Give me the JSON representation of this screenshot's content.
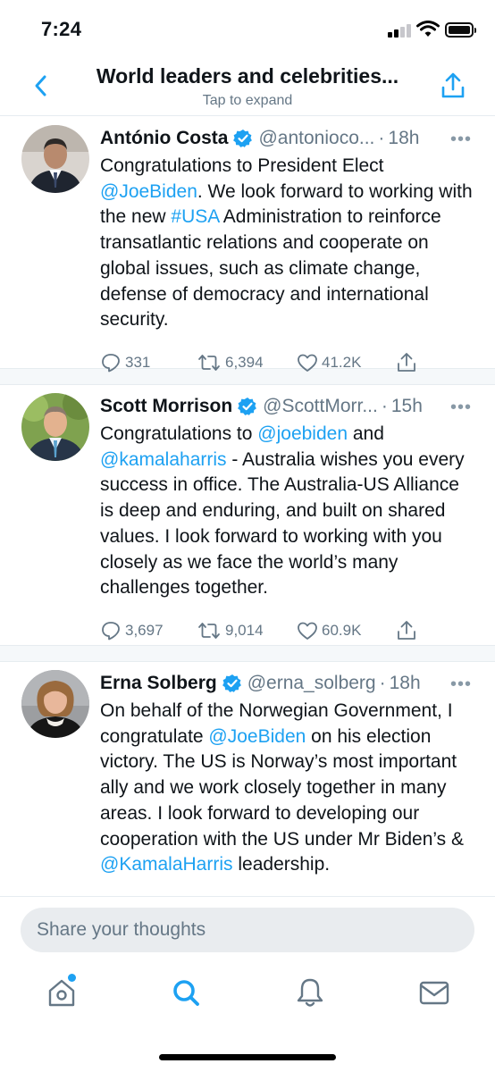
{
  "status_bar": {
    "time": "7:24"
  },
  "header": {
    "title": "World leaders and celebrities...",
    "subtitle": "Tap to expand"
  },
  "tweets": [
    {
      "name": "António Costa",
      "handle": "@antonioco...",
      "age": "18h",
      "dot": "·",
      "replies": "331",
      "retweets": "6,394",
      "likes": "41.2K"
    },
    {
      "name": "Scott Morrison",
      "handle": "@ScottMorr...",
      "age": "15h",
      "dot": "·",
      "replies": "3,697",
      "retweets": "9,014",
      "likes": "60.9K"
    },
    {
      "name": "Erna Solberg",
      "handle": "@erna_solberg",
      "age": "18h",
      "dot": "·"
    }
  ],
  "text": {
    "t1": [
      "Congratulations to President Elect ",
      "@JoeBiden",
      ". We look forward to working with the new ",
      "#USA",
      " Administration to reinforce transatlantic relations and cooperate on global issues, such as climate change, defense of democracy and international security."
    ],
    "t2": [
      "Congratulations to ",
      "@joebiden",
      " and ",
      "@kamalaharris",
      " - Australia wishes you every success in office. The Australia-US Alliance is deep and enduring, and built on shared values. I look forward to working with you closely as we face the world’s many challenges together."
    ],
    "t3": [
      "On behalf of the Norwegian Government, I congratulate ",
      "@JoeBiden",
      " on his election victory. The US is Norway’s most important ally and we work closely together in many areas. I look forward to developing our cooperation with the US under Mr Biden’s & ",
      "@KamalaHarris",
      " leadership."
    ]
  },
  "compose": {
    "placeholder": "Share your thoughts"
  },
  "colors": {
    "accent": "#1da1f2",
    "muted": "#657786",
    "text": "#0f1419"
  },
  "icons": [
    "back-chevron-icon",
    "share-icon",
    "verified-icon",
    "reply-icon",
    "retweet-icon",
    "like-icon",
    "home-icon",
    "search-icon",
    "bell-icon",
    "mail-icon"
  ]
}
